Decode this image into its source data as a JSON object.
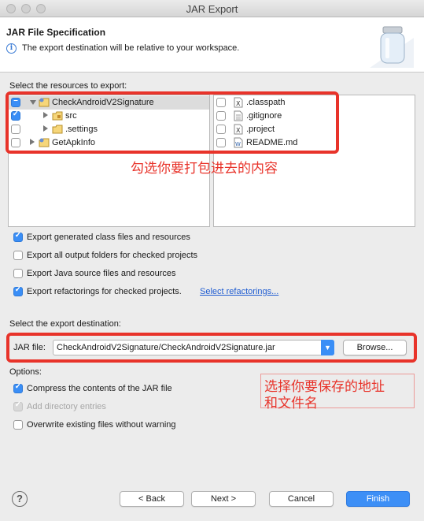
{
  "window": {
    "title": "JAR Export"
  },
  "header": {
    "title": "JAR File Specification",
    "description": "The export destination will be relative to your workspace."
  },
  "resources": {
    "label": "Select the resources to export:",
    "tree": [
      {
        "label": "CheckAndroidV2Signature",
        "check": "mixed",
        "expanded": true,
        "icon": "project-icon"
      },
      {
        "label": "src",
        "check": "checked",
        "expanded": false,
        "icon": "package-folder-icon"
      },
      {
        "label": ".settings",
        "check": "unchecked",
        "expanded": false,
        "icon": "folder-icon"
      },
      {
        "label": "GetApkInfo",
        "check": "unchecked",
        "expanded": false,
        "icon": "project-icon"
      }
    ],
    "files": [
      {
        "label": ".classpath",
        "check": "unchecked",
        "icon": "xml-file-icon"
      },
      {
        "label": ".gitignore",
        "check": "unchecked",
        "icon": "text-file-icon"
      },
      {
        "label": ".project",
        "check": "unchecked",
        "icon": "xml-file-icon"
      },
      {
        "label": "README.md",
        "check": "unchecked",
        "icon": "markdown-file-icon"
      }
    ]
  },
  "annotations": {
    "resources_note": "勾选你要打包进去的内容",
    "destination_note_line1": "选择你要保存的地址",
    "destination_note_line2": "和文件名",
    "color": "#e8332a"
  },
  "export_options": [
    {
      "label": "Export generated class files and resources",
      "checked": true
    },
    {
      "label": "Export all output folders for checked projects",
      "checked": false
    },
    {
      "label": "Export Java source files and resources",
      "checked": false
    },
    {
      "label": "Export refactorings for checked projects.",
      "checked": true
    }
  ],
  "refactorings_link": "Select refactorings...",
  "destination": {
    "label": "Select the export destination:",
    "jar_label": "JAR file:",
    "jar_value": "CheckAndroidV2Signature/CheckAndroidV2Signature.jar",
    "browse": "Browse..."
  },
  "options": {
    "label": "Options:",
    "items": [
      {
        "label": "Compress the contents of the JAR file",
        "checked": true,
        "enabled": true
      },
      {
        "label": "Add directory entries",
        "checked": true,
        "enabled": false
      },
      {
        "label": "Overwrite existing files without warning",
        "checked": false,
        "enabled": true
      }
    ]
  },
  "footer": {
    "back": "< Back",
    "next": "Next >",
    "cancel": "Cancel",
    "finish": "Finish",
    "accent": "#3d8ff6"
  }
}
